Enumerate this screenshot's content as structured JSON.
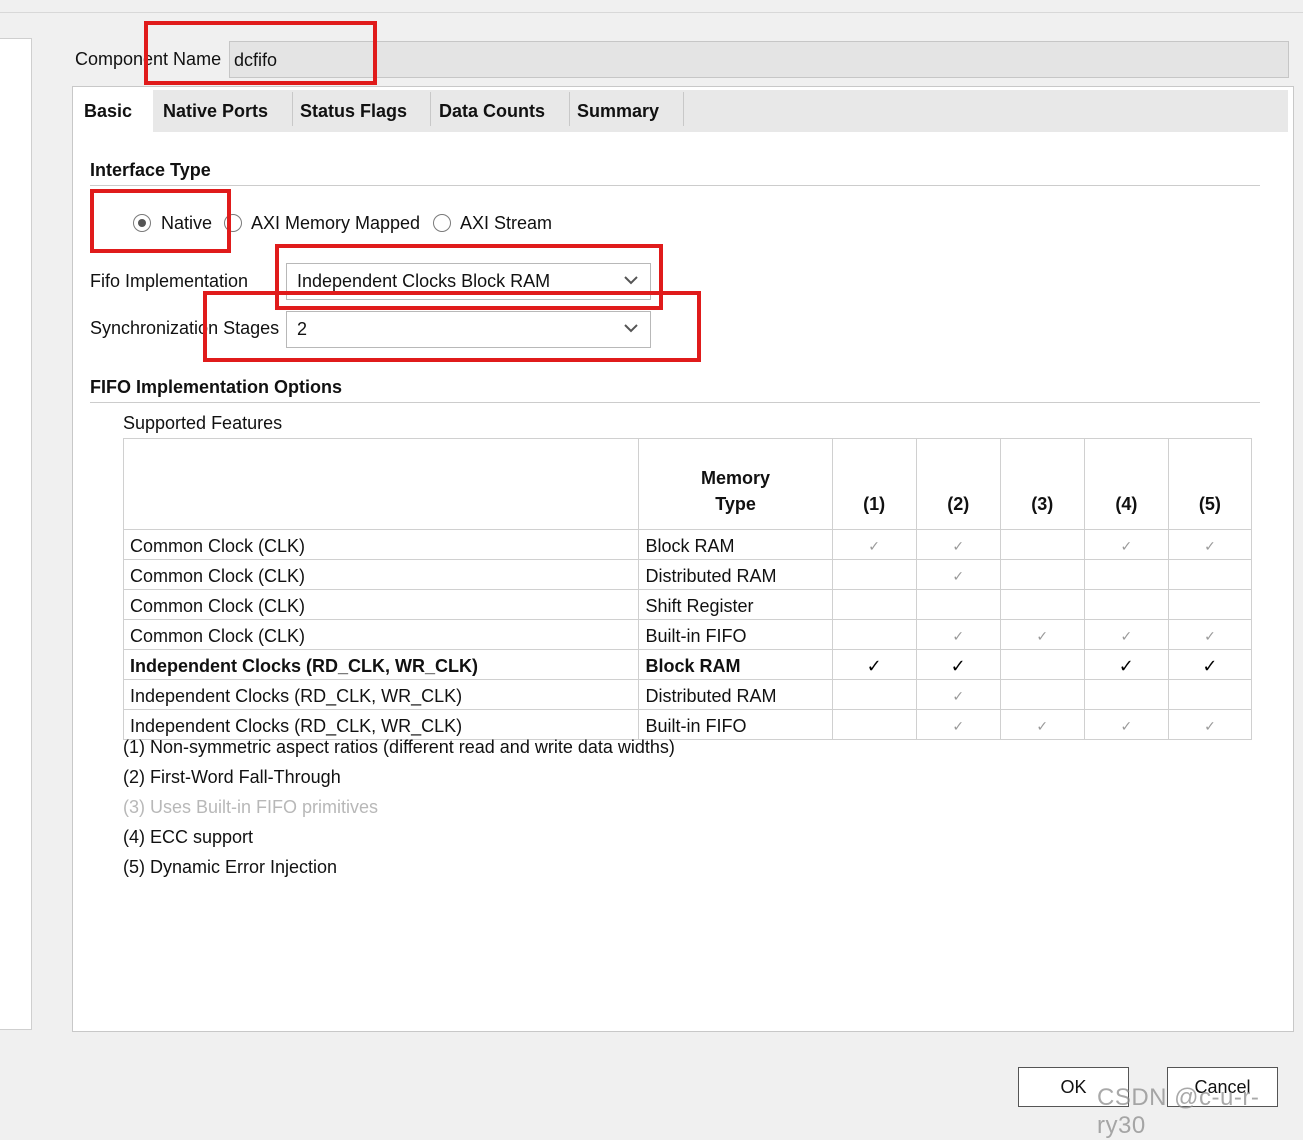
{
  "component": {
    "label": "Component Name",
    "value": "dcfifo"
  },
  "tabs": [
    {
      "label": "Basic"
    },
    {
      "label": "Native Ports"
    },
    {
      "label": "Status Flags"
    },
    {
      "label": "Data Counts"
    },
    {
      "label": "Summary"
    }
  ],
  "interface": {
    "title": "Interface Type",
    "options": [
      "Native",
      "AXI Memory Mapped",
      "AXI Stream"
    ],
    "selected": "Native"
  },
  "fifo_impl": {
    "label": "Fifo Implementation",
    "value": "Independent Clocks Block RAM"
  },
  "sync_stages": {
    "label": "Synchronization Stages",
    "value": "2"
  },
  "options_section": {
    "title": "FIFO Implementation Options",
    "subtitle": "Supported Features"
  },
  "table": {
    "header_memory": [
      "Memory",
      "Type"
    ],
    "feature_cols": [
      "(1)",
      "(2)",
      "(3)",
      "(4)",
      "(5)"
    ],
    "check_glyph": "✓",
    "rows": [
      {
        "clock": "Common Clock (CLK)",
        "memory": "Block RAM",
        "checks": [
          true,
          true,
          false,
          true,
          true
        ],
        "highlight": false
      },
      {
        "clock": "Common Clock (CLK)",
        "memory": "Distributed RAM",
        "checks": [
          false,
          true,
          false,
          false,
          false
        ],
        "highlight": false
      },
      {
        "clock": "Common Clock (CLK)",
        "memory": "Shift Register",
        "checks": [
          false,
          false,
          false,
          false,
          false
        ],
        "highlight": false
      },
      {
        "clock": "Common Clock (CLK)",
        "memory": "Built-in FIFO",
        "checks": [
          false,
          true,
          true,
          true,
          true
        ],
        "highlight": false
      },
      {
        "clock": "Independent Clocks (RD_CLK, WR_CLK)",
        "memory": "Block RAM",
        "checks": [
          true,
          true,
          false,
          true,
          true
        ],
        "highlight": true
      },
      {
        "clock": "Independent Clocks (RD_CLK, WR_CLK)",
        "memory": "Distributed RAM",
        "checks": [
          false,
          true,
          false,
          false,
          false
        ],
        "highlight": false
      },
      {
        "clock": "Independent Clocks (RD_CLK, WR_CLK)",
        "memory": "Built-in FIFO",
        "checks": [
          false,
          true,
          true,
          true,
          true
        ],
        "highlight": false
      }
    ]
  },
  "notes": [
    {
      "text": "(1) Non-symmetric aspect ratios (different read and write data widths)",
      "dim": false
    },
    {
      "text": "(2) First-Word Fall-Through",
      "dim": false
    },
    {
      "text": "(3) Uses Built-in FIFO primitives",
      "dim": true
    },
    {
      "text": "(4) ECC support",
      "dim": false
    },
    {
      "text": "(5) Dynamic Error Injection",
      "dim": false
    }
  ],
  "buttons": {
    "ok": "OK",
    "cancel": "Cancel"
  },
  "watermark": "CSDN @c-u-r-ry30",
  "colors": {
    "highlight_box": "#e01b1b",
    "panel_bg": "#ffffff",
    "window_bg": "#f0f0f0"
  }
}
